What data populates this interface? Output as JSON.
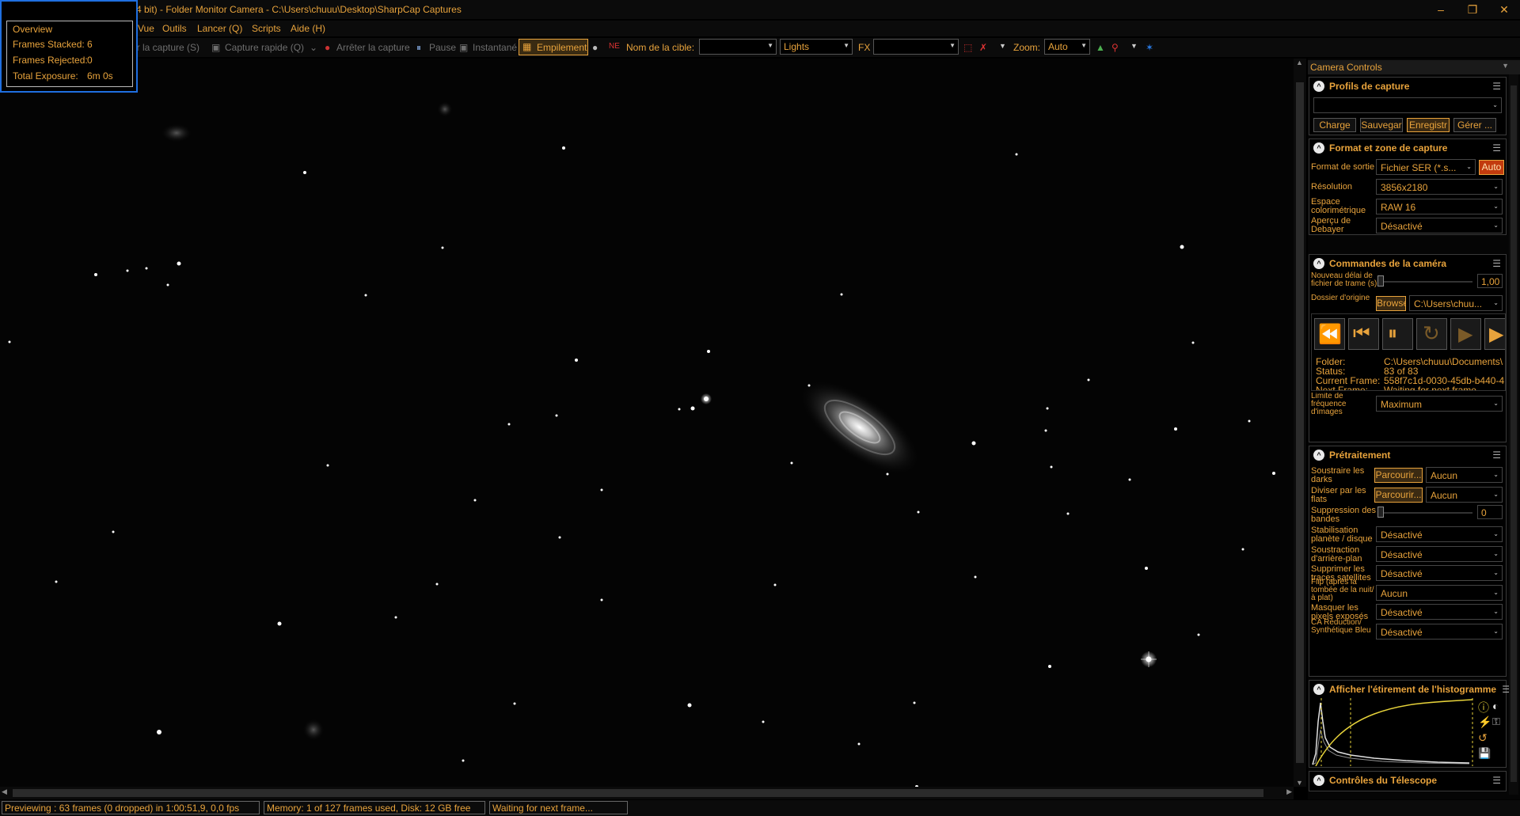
{
  "window": {
    "title": "4 bit) - Folder Monitor Camera - C:\\Users\\chuuu\\Desktop\\SharpCap Captures",
    "minimize_glyph": "–",
    "restore_glyph": "❐",
    "close_glyph": "✕"
  },
  "menu": [
    "Vue",
    "Outils",
    "Lancer (Q)",
    "Scripts",
    "Aide (H)"
  ],
  "toolbar": {
    "start_capture": "cer la capture (S)",
    "quick_capture": "Capture rapide (Q)",
    "stop_capture": "Arrêter la capture",
    "pause": "Pause",
    "snapshot": "Instantané",
    "stacking": "Empilement",
    "target_name_label": "Nom de la cible:",
    "target_name_value": "",
    "frame_type": "Lights",
    "fx_label": "FX",
    "fx_value": "",
    "zoom_label": "Zoom:",
    "zoom_value": "Auto"
  },
  "overview": {
    "title": "Overview",
    "frames_stacked_label": "Frames Stacked:",
    "frames_stacked": "6",
    "frames_rejected_label": "Frames Rejected:",
    "frames_rejected": "0",
    "total_exposure_label": "Total Exposure:",
    "total_exposure": "6m 0s"
  },
  "panel": {
    "title": "Camera Controls",
    "profiles": {
      "title": "Profils de capture",
      "selected": "",
      "buttons": [
        "Charge",
        "Sauvegar",
        "Enregistr",
        "Gérer ..."
      ]
    },
    "format": {
      "title": "Format et zone de capture",
      "output_format_label": "Format de sortie",
      "output_format": "Fichier SER (*.s...",
      "auto_label": "Auto",
      "resolution_label": "Résolution",
      "resolution": "3856x2180",
      "colorspace_label": "Espace colorimétrique",
      "colorspace": "RAW 16",
      "debayer_label": "Aperçu de Debayer",
      "debayer": "Désactivé"
    },
    "camera": {
      "title": "Commandes de la caméra",
      "delay_label": "Nouveau délai de fichier de trame (s)",
      "delay_value": "1,00",
      "folder_label": "Dossier d'origine",
      "browse_label": "Browse",
      "folder_value": "C:\\Users\\chuu...",
      "info": {
        "folder_label": "Folder:",
        "folder": "C:\\Users\\chuuu\\Documents\\",
        "status_label": "Status:",
        "status": "83 of 83",
        "current_label": "Current Frame:",
        "current": "558f7c1d-0030-45db-b440-4",
        "next_label": "Next Frame:",
        "next": "Waiting for next frame..."
      },
      "fps_limit_label": "Limite de fréquence d'images",
      "fps_limit": "Maximum"
    },
    "preprocessing": {
      "title": "Prétraitement",
      "darks_label": "Soustraire les darks",
      "flats_label": "Diviser par les flats",
      "browse_label": "Parcourir...",
      "darks_value": "Aucun",
      "flats_value": "Aucun",
      "banding_label": "Suppression des bandes",
      "banding_value": "0",
      "stabilization_label": "Stabilisation planète / disque",
      "stabilization": "Désactivé",
      "background_label": "Soustraction d'arrière-plan",
      "background": "Désactivé",
      "satellite_label": "Supprimer les traces satellites",
      "satellite": "Désactivé",
      "flip_label": "Flip (après la tombée de la nuit/à plat)",
      "flip": "Aucun",
      "hotpixel_label": "Masquer les pixels exposés",
      "hotpixel": "Désactivé",
      "ca_label": "CA Réduction/ Synthétique Bleu",
      "ca": "Désactivé"
    },
    "histogram": {
      "title": "Afficher l'étirement de l'histogramme"
    },
    "telescope": {
      "title": "Contrôles du Télescope"
    }
  },
  "status": {
    "preview": "Previewing : 63 frames (0 dropped) in 1:00:51,9, 0,0 fps",
    "memory": "Memory: 1 of 127 frames used, Disk: 12 GB free",
    "waiting": "Waiting for next frame..."
  },
  "colors": {
    "accent": "#e8a33c",
    "highlight_border": "#1f6fe0",
    "auto_button": "#c23b0e"
  },
  "icons": [
    "camera-icon",
    "stop-icon",
    "pause-icon",
    "snapshot-icon",
    "stack-icon",
    "rewind-icon",
    "step-back-icon",
    "pause-playback-icon",
    "refresh-icon",
    "play-icon",
    "step-forward-icon"
  ]
}
